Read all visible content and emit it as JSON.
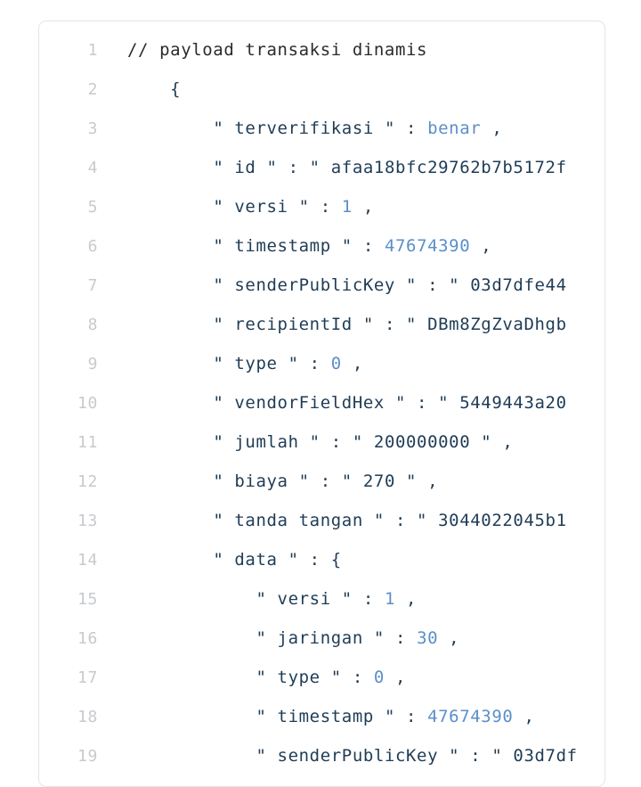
{
  "editor": {
    "language": "json",
    "colors": {
      "background": "#ffffff",
      "card_border": "#e3e5e8",
      "line_number": "#c7cacd",
      "text": "#1f3c56",
      "comment": "#2b2b2b",
      "number": "#5b8fc9",
      "boolean": "#5b8fc9"
    },
    "lines": [
      {
        "n": "1",
        "indent": 0,
        "tokens": [
          {
            "t": "comment",
            "v": "// payload transaksi dinamis"
          }
        ]
      },
      {
        "n": "2",
        "indent": 1,
        "tokens": [
          {
            "t": "punct",
            "v": "{"
          }
        ]
      },
      {
        "n": "3",
        "indent": 2,
        "tokens": [
          {
            "t": "punct",
            "v": "\" "
          },
          {
            "t": "key",
            "v": "terverifikasi"
          },
          {
            "t": "punct",
            "v": " \" : "
          },
          {
            "t": "bool",
            "v": "benar"
          },
          {
            "t": "punct",
            "v": " ,"
          }
        ]
      },
      {
        "n": "4",
        "indent": 2,
        "tokens": [
          {
            "t": "punct",
            "v": "\" "
          },
          {
            "t": "key",
            "v": "id"
          },
          {
            "t": "punct",
            "v": " \" : \" "
          },
          {
            "t": "string",
            "v": "afaa18bfc29762b7b5172f"
          }
        ]
      },
      {
        "n": "5",
        "indent": 2,
        "tokens": [
          {
            "t": "punct",
            "v": "\" "
          },
          {
            "t": "key",
            "v": "versi"
          },
          {
            "t": "punct",
            "v": " \" : "
          },
          {
            "t": "number",
            "v": "1"
          },
          {
            "t": "punct",
            "v": " ,"
          }
        ]
      },
      {
        "n": "6",
        "indent": 2,
        "tokens": [
          {
            "t": "punct",
            "v": "\" "
          },
          {
            "t": "key",
            "v": "timestamp"
          },
          {
            "t": "punct",
            "v": " \" : "
          },
          {
            "t": "number",
            "v": "47674390"
          },
          {
            "t": "punct",
            "v": " ,"
          }
        ]
      },
      {
        "n": "7",
        "indent": 2,
        "tokens": [
          {
            "t": "punct",
            "v": "\" "
          },
          {
            "t": "key",
            "v": "senderPublicKey"
          },
          {
            "t": "punct",
            "v": " \" : \" "
          },
          {
            "t": "string",
            "v": "03d7dfe44"
          }
        ]
      },
      {
        "n": "8",
        "indent": 2,
        "tokens": [
          {
            "t": "punct",
            "v": "\" "
          },
          {
            "t": "key",
            "v": "recipientId"
          },
          {
            "t": "punct",
            "v": " \" : \" "
          },
          {
            "t": "string",
            "v": "DBm8ZgZvaDhgb"
          }
        ]
      },
      {
        "n": "9",
        "indent": 2,
        "tokens": [
          {
            "t": "punct",
            "v": "\" "
          },
          {
            "t": "key",
            "v": "type"
          },
          {
            "t": "punct",
            "v": " \" : "
          },
          {
            "t": "number",
            "v": "0"
          },
          {
            "t": "punct",
            "v": " ,"
          }
        ]
      },
      {
        "n": "10",
        "indent": 2,
        "tokens": [
          {
            "t": "punct",
            "v": "\" "
          },
          {
            "t": "key",
            "v": "vendorFieldHex"
          },
          {
            "t": "punct",
            "v": " \" : \" "
          },
          {
            "t": "string",
            "v": "5449443a20"
          }
        ]
      },
      {
        "n": "11",
        "indent": 2,
        "tokens": [
          {
            "t": "punct",
            "v": "\" "
          },
          {
            "t": "key",
            "v": "jumlah"
          },
          {
            "t": "punct",
            "v": " \" : \" "
          },
          {
            "t": "string",
            "v": "200000000"
          },
          {
            "t": "punct",
            "v": " \" ,"
          }
        ]
      },
      {
        "n": "12",
        "indent": 2,
        "tokens": [
          {
            "t": "punct",
            "v": "\" "
          },
          {
            "t": "key",
            "v": "biaya"
          },
          {
            "t": "punct",
            "v": " \" : \" "
          },
          {
            "t": "string",
            "v": "270"
          },
          {
            "t": "punct",
            "v": " \" ,"
          }
        ]
      },
      {
        "n": "13",
        "indent": 2,
        "tokens": [
          {
            "t": "punct",
            "v": "\" "
          },
          {
            "t": "key",
            "v": "tanda tangan"
          },
          {
            "t": "punct",
            "v": " \" : \" "
          },
          {
            "t": "string",
            "v": "3044022045b1"
          }
        ]
      },
      {
        "n": "14",
        "indent": 2,
        "tokens": [
          {
            "t": "punct",
            "v": "\" "
          },
          {
            "t": "key",
            "v": "data"
          },
          {
            "t": "punct",
            "v": " \" : {"
          }
        ]
      },
      {
        "n": "15",
        "indent": 3,
        "tokens": [
          {
            "t": "punct",
            "v": "\" "
          },
          {
            "t": "key",
            "v": "versi"
          },
          {
            "t": "punct",
            "v": " \" : "
          },
          {
            "t": "number",
            "v": "1"
          },
          {
            "t": "punct",
            "v": " ,"
          }
        ]
      },
      {
        "n": "16",
        "indent": 3,
        "tokens": [
          {
            "t": "punct",
            "v": "\" "
          },
          {
            "t": "key",
            "v": "jaringan"
          },
          {
            "t": "punct",
            "v": " \" : "
          },
          {
            "t": "number",
            "v": "30"
          },
          {
            "t": "punct",
            "v": " ,"
          }
        ]
      },
      {
        "n": "17",
        "indent": 3,
        "tokens": [
          {
            "t": "punct",
            "v": "\" "
          },
          {
            "t": "key",
            "v": "type"
          },
          {
            "t": "punct",
            "v": " \" : "
          },
          {
            "t": "number",
            "v": "0"
          },
          {
            "t": "punct",
            "v": " ,"
          }
        ]
      },
      {
        "n": "18",
        "indent": 3,
        "tokens": [
          {
            "t": "punct",
            "v": "\" "
          },
          {
            "t": "key",
            "v": "timestamp"
          },
          {
            "t": "punct",
            "v": " \" : "
          },
          {
            "t": "number",
            "v": "47674390"
          },
          {
            "t": "punct",
            "v": " ,"
          }
        ]
      },
      {
        "n": "19",
        "indent": 3,
        "tokens": [
          {
            "t": "punct",
            "v": "\" "
          },
          {
            "t": "key",
            "v": "senderPublicKey"
          },
          {
            "t": "punct",
            "v": " \" : \" "
          },
          {
            "t": "string",
            "v": "03d7df"
          }
        ]
      }
    ]
  }
}
